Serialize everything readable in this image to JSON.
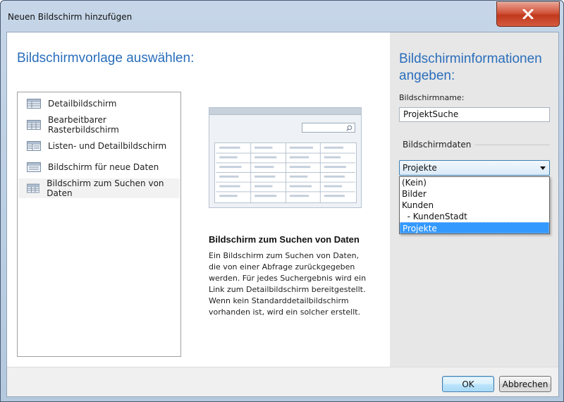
{
  "window": {
    "title": "Neuen Bildschirm hinzufügen"
  },
  "left": {
    "heading": "Bildschirmvorlage auswählen:",
    "templates": [
      {
        "label": "Detailbildschirm"
      },
      {
        "label": "Bearbeitbarer Rasterbildschirm"
      },
      {
        "label": "Listen- und Detailbildschirm"
      },
      {
        "label": "Bildschirm für neue Daten"
      },
      {
        "label": "Bildschirm zum Suchen von Daten"
      }
    ],
    "selected_index": 4,
    "description_title": "Bildschirm zum Suchen von Daten",
    "description": "Ein Bildschirm zum Suchen von Daten, die von einer Abfrage zurückgegeben werden. Für jedes Suchergebnis wird ein Link zum Detailbildschirm bereitgestellt. Wenn kein Standarddetailbildschirm vorhanden ist, wird ein solcher erstellt."
  },
  "right": {
    "heading": "Bildschirminformationen angeben:",
    "name_label": "Bildschirmname:",
    "name_value": "ProjektSuche",
    "data_label": "Bildschirmdaten",
    "data_selected": "Projekte",
    "data_options": [
      "(Kein)",
      "Bilder",
      "Kunden",
      "  - KundenStadt",
      "Projekte"
    ],
    "data_highlighted_index": 4
  },
  "footer": {
    "ok_label": "OK",
    "cancel_label": "Abbrechen"
  },
  "colors": {
    "heading": "#2a6ebb",
    "selection": "#3399ff",
    "close": "#c0391d"
  },
  "icons": {
    "close": "close-icon",
    "template": "grid-template-icon",
    "search": "search-icon",
    "dropdown": "chevron-down-icon"
  }
}
